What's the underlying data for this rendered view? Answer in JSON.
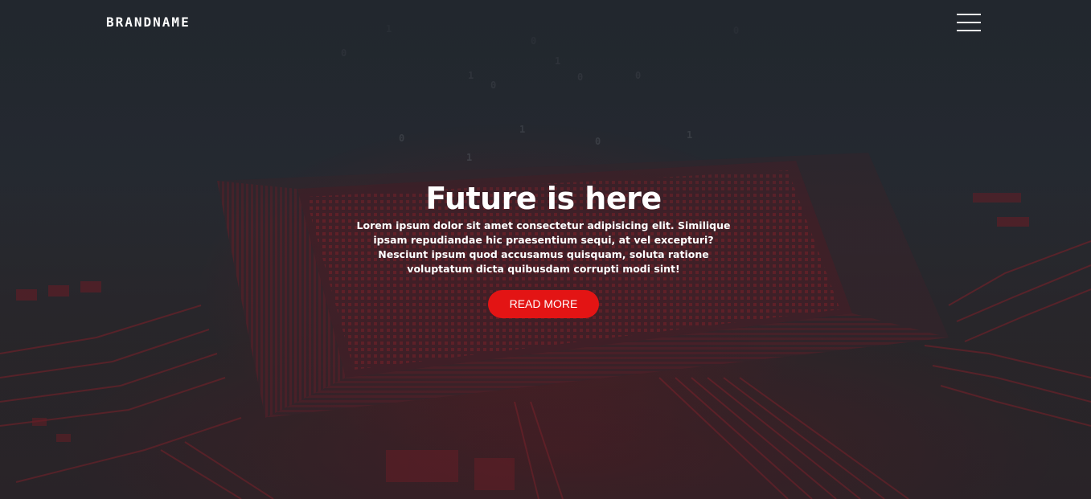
{
  "navbar": {
    "brand": "BRANDNAME",
    "menu_icon": "hamburger-menu-icon"
  },
  "hero": {
    "background": "circuit-board-image",
    "title": "Future is here",
    "description": "Lorem ipsum dolor sit amet consectetur adipisicing elit. Similique ipsam repudiandae hic praesentium sequi, at vel excepturi? Nesciunt ipsum quod accusamus quisquam, soluta ratione voluptatum dicta quibusdam corrupti modi sint!",
    "button_label": "READ MORE"
  },
  "colors": {
    "background": "#22272e",
    "accent": "#e31414",
    "text": "#ffffff"
  }
}
